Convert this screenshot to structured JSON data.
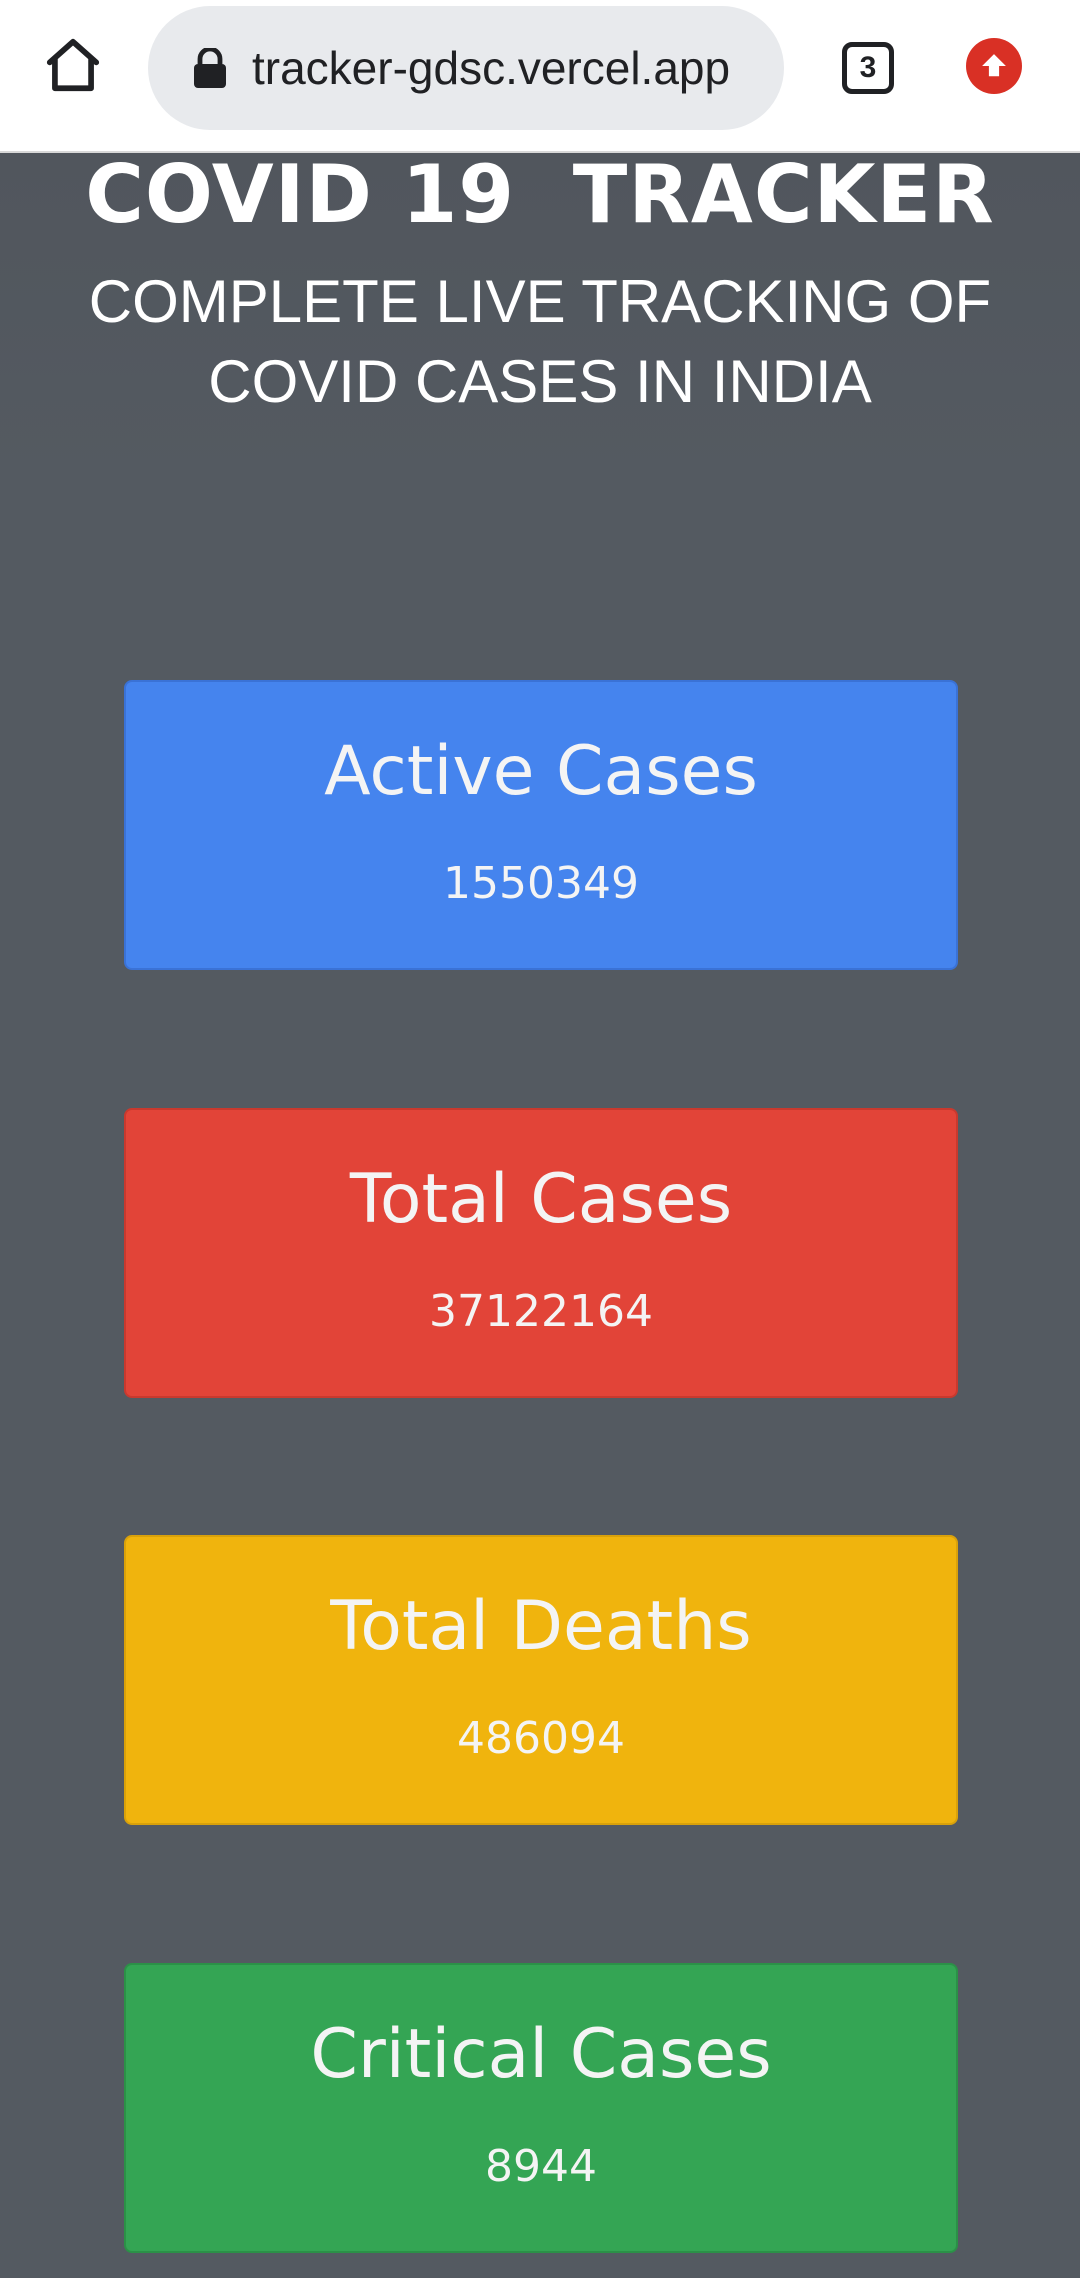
{
  "browser": {
    "url": "tracker-gdsc.vercel.app",
    "tab_count": "3",
    "icons": {
      "home": "home-icon",
      "lock": "lock-icon",
      "tabs": "tab-switcher-icon",
      "update": "update-arrow-icon"
    },
    "update_color": "#d93025"
  },
  "header": {
    "title": "COVID 19  TRACKER",
    "subtitle": "COMPLETE LIVE TRACKING OF COVID CASES IN INDIA"
  },
  "stats": [
    {
      "label": "Active Cases",
      "value": "1550349",
      "color": "#4584ee"
    },
    {
      "label": "Total Cases",
      "value": "37122164",
      "color": "#e24438"
    },
    {
      "label": "Total Deaths",
      "value": "486094",
      "color": "#f0b40d"
    },
    {
      "label": "Critical Cases",
      "value": "8944",
      "color": "#34a554"
    }
  ],
  "theme": {
    "background": "#545a61"
  }
}
